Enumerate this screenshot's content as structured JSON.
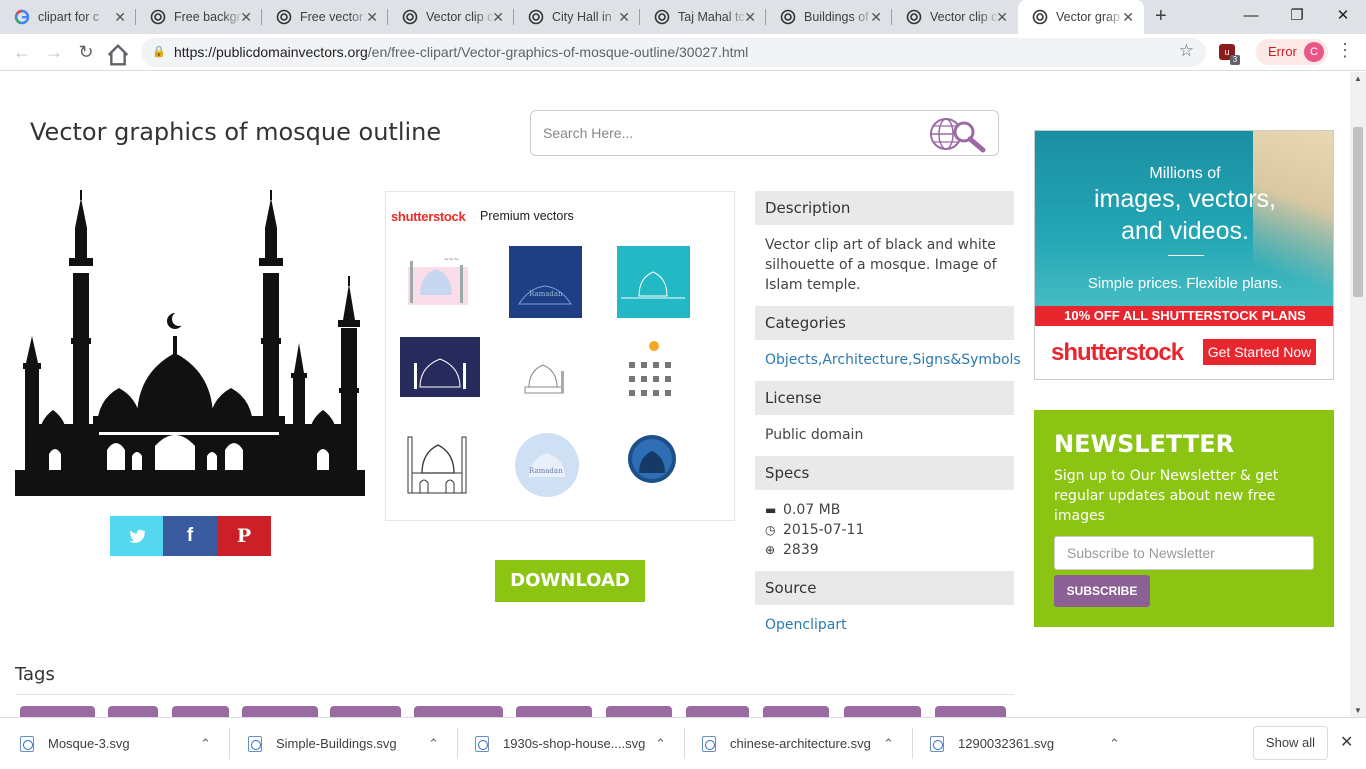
{
  "browser": {
    "tabs": [
      {
        "title": "clipart for c",
        "favicon": "google-icon"
      },
      {
        "title": "Free backgr",
        "favicon": "pdv-icon"
      },
      {
        "title": "Free vector",
        "favicon": "pdv-icon"
      },
      {
        "title": "Vector clip c",
        "favicon": "pdv-icon"
      },
      {
        "title": "City Hall in",
        "favicon": "pdv-icon"
      },
      {
        "title": "Taj Mahal tc",
        "favicon": "pdv-icon"
      },
      {
        "title": "Buildings of",
        "favicon": "pdv-icon"
      },
      {
        "title": "Vector clip c",
        "favicon": "pdv-icon"
      },
      {
        "title": "Vector grap",
        "favicon": "pdv-icon",
        "active": true
      }
    ],
    "url_host": "https://publicdomainvectors.org",
    "url_path": "/en/free-clipart/Vector-graphics-of-mosque-outline/30027.html",
    "extension_badge": "3",
    "error_label": "Error",
    "profile_initial": "C"
  },
  "page": {
    "title": "Vector graphics of mosque outline",
    "search_placeholder": "Search Here...",
    "shutterstock_logo": "shutterstock",
    "premium_label": "Premium vectors",
    "download_label": "DOWNLOAD",
    "info": {
      "description_head": "Description",
      "description": "Vector clip art of black and white silhouette of a mosque. Image of Islam temple.",
      "categories_head": "Categories",
      "categories": [
        "Objects",
        "Architecture",
        "Signs&Symbols"
      ],
      "license_head": "License",
      "license": "Public domain",
      "specs_head": "Specs",
      "size": "0.07 MB",
      "date": "2015-07-11",
      "downloads": "2839",
      "source_head": "Source",
      "source": "Openclipart"
    },
    "ad": {
      "line1": "Millions of",
      "line2": "images, vectors,",
      "line3": "and videos.",
      "line4": "Simple prices. Flexible plans.",
      "offer": "10% OFF ALL SHUTTERSTOCK PLANS",
      "logo": "shutterstock",
      "cta": "Get Started Now"
    },
    "newsletter": {
      "heading": "NEWSLETTER",
      "text": "Sign up to Our Newsletter & get regular updates about new free images",
      "placeholder": "Subscribe to Newsletter",
      "button": "SUBSCRIBE"
    },
    "tags_heading": "Tags"
  },
  "downloads": {
    "items": [
      "Mosque-3.svg",
      "Simple-Buildings.svg",
      "1930s-shop-house....svg",
      "chinese-architecture.svg",
      "1290032361.svg"
    ],
    "show_all": "Show all"
  },
  "colors": {
    "accent_green": "#8cc414",
    "purple": "#8b6094",
    "link": "#2a7ab0",
    "shutterstock_red": "#e7262e"
  }
}
